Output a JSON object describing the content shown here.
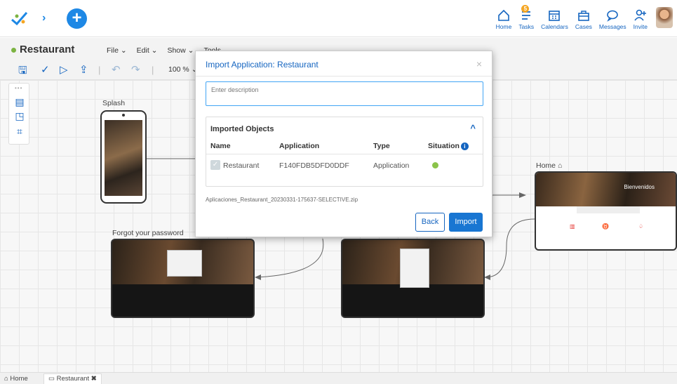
{
  "topbar": {
    "nav": [
      {
        "label": "Home",
        "icon": "home-icon"
      },
      {
        "label": "Tasks",
        "icon": "tasks-icon",
        "badge": "5"
      },
      {
        "label": "Calendars",
        "icon": "calendar-icon"
      },
      {
        "label": "Cases",
        "icon": "briefcase-icon"
      },
      {
        "label": "Messages",
        "icon": "message-icon"
      },
      {
        "label": "Invite",
        "icon": "invite-user-icon"
      }
    ]
  },
  "app": {
    "title": "Restaurant",
    "status_color": "#7cb342",
    "menu": [
      "File ⌄",
      "Edit ⌄",
      "Show ⌄",
      "Tools ⌄"
    ],
    "zoom": "100 % ⌄"
  },
  "canvas": {
    "nodes": {
      "splash": "Splash",
      "forgot": "Forgot your password",
      "home": "Home",
      "welcome": "Bienvenidos"
    }
  },
  "modal": {
    "title": "Import Application: Restaurant",
    "close": "×",
    "description_placeholder": "Enter description",
    "objects": {
      "title": "Imported Objects",
      "columns": [
        "Name",
        "Application",
        "Type",
        "Situation"
      ],
      "rows": [
        {
          "name": "Restaurant",
          "application": "F140FDB5DFD0DDF",
          "type": "Application",
          "situation_color": "#8bc34a"
        }
      ]
    },
    "filename": "Aplicaciones_Restaurant_20230331-175637-SELECTIVE.zip",
    "back_label": "Back",
    "import_label": "Import"
  },
  "tabs": [
    {
      "label": "Home",
      "icon": "home-icon"
    },
    {
      "label": "Restaurant",
      "icon": "window-icon",
      "close": "✖"
    }
  ],
  "colors": {
    "accent": "#1565c0",
    "primary_button": "#1976d2"
  }
}
